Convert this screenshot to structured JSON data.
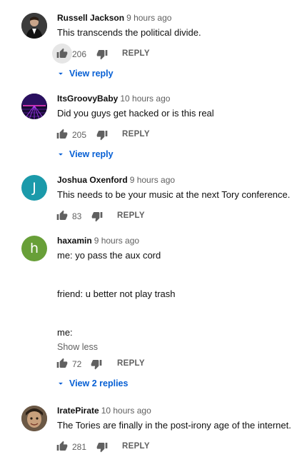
{
  "comments": [
    {
      "author": "Russell Jackson",
      "time": "9 hours ago",
      "lines": [
        "This transcends the political divide."
      ],
      "likes": "206",
      "reply_label": "REPLY",
      "view_replies": "View reply",
      "avatar": {
        "type": "photo",
        "bg": "#2e2e2e"
      }
    },
    {
      "author": "ItsGroovyBaby",
      "time": "10 hours ago",
      "lines": [
        "Did you guys get hacked or is this real"
      ],
      "likes": "205",
      "reply_label": "REPLY",
      "view_replies": "View reply",
      "avatar": {
        "type": "photo",
        "bg": "#1b0f3a"
      }
    },
    {
      "author": "Joshua Oxenford",
      "time": "9 hours ago",
      "lines": [
        "This needs to be your music at the next Tory conference."
      ],
      "likes": "83",
      "reply_label": "REPLY",
      "avatar": {
        "type": "letter",
        "letter": "J",
        "bg": "#1b9aaa"
      }
    },
    {
      "author": "haxamin",
      "time": "9 hours ago",
      "lines": [
        "me:  yo pass the aux cord",
        "",
        "friend:  u better not play trash",
        "",
        "me:"
      ],
      "show_less": "Show less",
      "likes": "72",
      "reply_label": "REPLY",
      "view_replies": "View 2 replies",
      "avatar": {
        "type": "letter",
        "letter": "h",
        "bg": "#689f38"
      }
    },
    {
      "author": "IratePirate",
      "time": "10 hours ago",
      "lines": [
        "The Tories are finally in the post-irony age of the internet."
      ],
      "likes": "281",
      "reply_label": "REPLY",
      "avatar": {
        "type": "photo",
        "bg": "#5a4a3a"
      }
    }
  ],
  "colors": {
    "link_blue": "#065fd4",
    "muted_text": "#606060",
    "icon_gray": "#606060"
  }
}
